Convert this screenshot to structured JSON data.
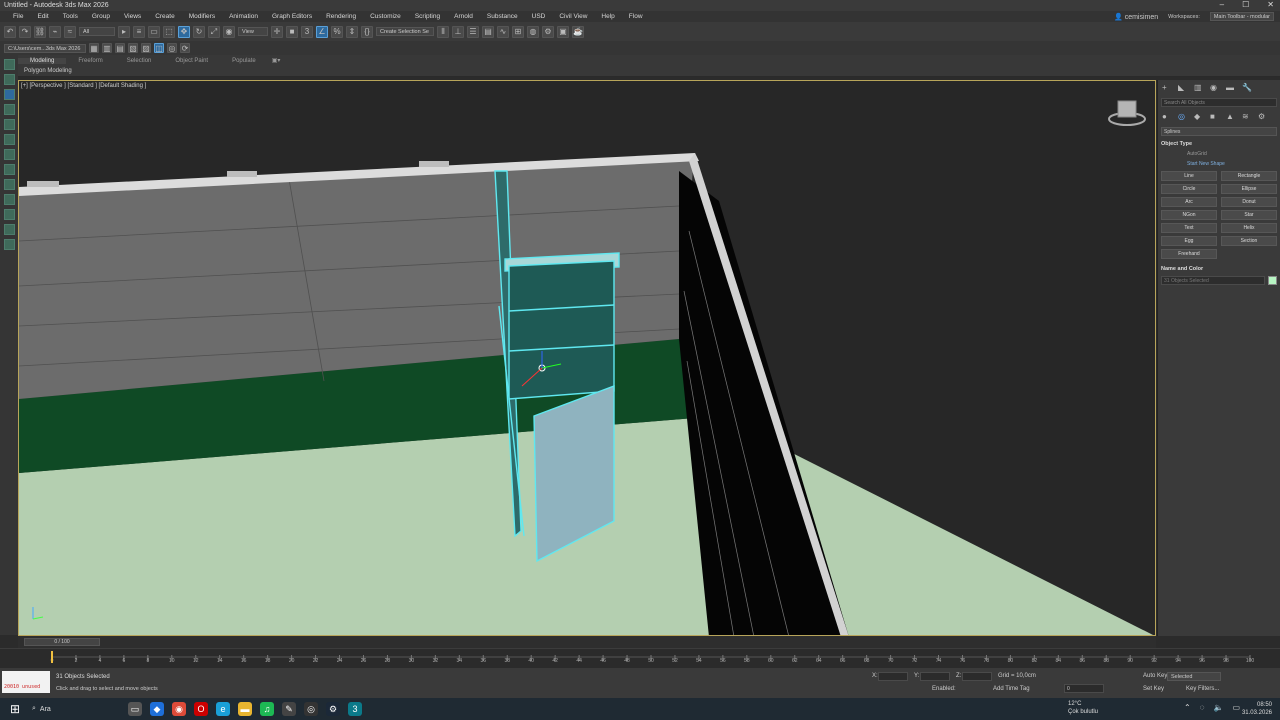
{
  "window": {
    "title": "Untitled - Autodesk 3ds Max 2026",
    "min": "–",
    "max": "☐",
    "close": "✕"
  },
  "menu": {
    "items": [
      "File",
      "Edit",
      "Tools",
      "Group",
      "Views",
      "Create",
      "Modifiers",
      "Animation",
      "Graph Editors",
      "Rendering",
      "Customize",
      "Scripting",
      "Arnold",
      "Substance",
      "USD",
      "Civil View",
      "Help",
      "Flow"
    ],
    "user": "cemisimen",
    "workspaces_label": "Workspaces:",
    "workspace_value": "Main Toolbar - modular"
  },
  "toolbar": {
    "filter_value": "All",
    "view_value": "View",
    "selection_set_placeholder": "Create Selection Se",
    "path_value": "C:\\Users\\cem...3ds Max 2026"
  },
  "ribbon": {
    "tabs": [
      "Modeling",
      "Freeform",
      "Selection",
      "Object Paint",
      "Populate"
    ],
    "panel_label": "Polygon Modeling"
  },
  "viewport": {
    "label": "[+] [Perspective ] [Standard ] [Default Shading ]"
  },
  "command_panel": {
    "search_placeholder": "Search All Objects",
    "category": "Splines",
    "object_type_title": "Object Type",
    "autogrid": "AutoGrid",
    "start_new_shape": "Start New Shape",
    "buttons": [
      "Line",
      "Rectangle",
      "Circle",
      "Ellipse",
      "Arc",
      "Donut",
      "NGon",
      "Star",
      "Text",
      "Helix",
      "Egg",
      "Section",
      "Freehand"
    ],
    "name_color_title": "Name and Color",
    "name_value": "31 Objects Selected",
    "color": "#b7f5c3"
  },
  "timeline": {
    "frame_display": "0 / 100",
    "ticks": [
      "0",
      "2",
      "4",
      "6",
      "8",
      "10",
      "12",
      "14",
      "16",
      "18",
      "20",
      "22",
      "24",
      "26",
      "28",
      "30",
      "32",
      "34",
      "36",
      "38",
      "40",
      "42",
      "44",
      "46",
      "48",
      "50",
      "52",
      "54",
      "56",
      "58",
      "60",
      "62",
      "64",
      "66",
      "68",
      "70",
      "72",
      "74",
      "76",
      "78",
      "80",
      "82",
      "84",
      "86",
      "88",
      "90",
      "92",
      "94",
      "96",
      "98",
      "100"
    ]
  },
  "status": {
    "maxscript_text": "20010 unused",
    "selected": "31 Objects Selected",
    "prompt": "Click and drag to select and move objects",
    "x_label": "X:",
    "y_label": "Y:",
    "z_label": "Z:",
    "grid": "Grid = 10,0cm",
    "enabled": "Enabled:",
    "add_time_tag": "Add Time Tag",
    "auto_key": "Auto Key",
    "set_key": "Set Key",
    "selected_dd": "Selected",
    "key_filters": "Key Filters...",
    "frame_field": "0"
  },
  "taskbar": {
    "search_label": "Ara",
    "weather_temp": "12°C",
    "weather_desc": "Çok bulutlu",
    "time": "08:50",
    "date": "31.03.2026"
  },
  "colors": {
    "viewport_border": "#b8a55a",
    "selection": "#5fe8f0",
    "wall_green": "#0f4a25",
    "floor": "#b4cfb0"
  }
}
